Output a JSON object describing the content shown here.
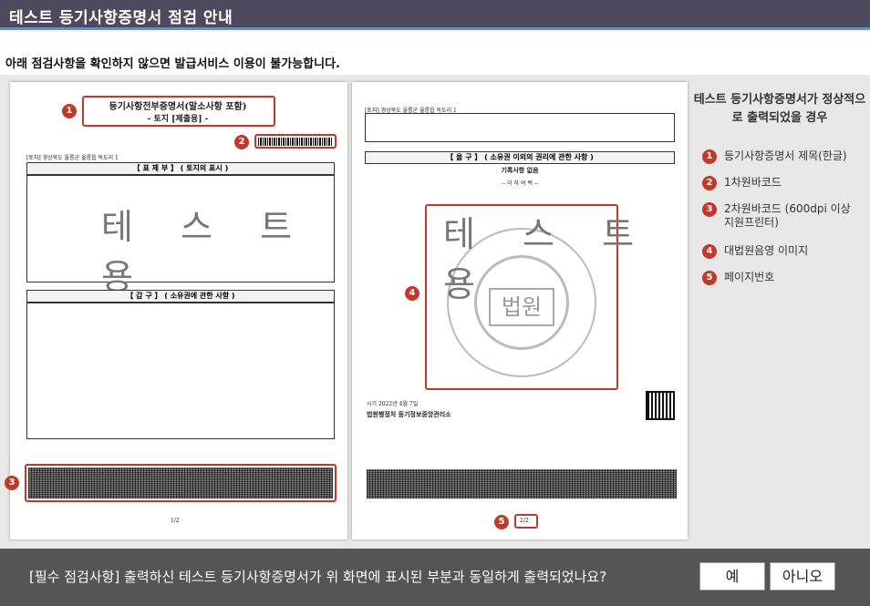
{
  "header": {
    "title": "테스트 등기사항증명서 점검 안내"
  },
  "notice": "아래 점검사항을 확인하지 않으면 발급서비스 이용이 불가능합니다.",
  "page1": {
    "doc_title": "등기사항전부증명서(말소사항 포함)",
    "doc_subtitle": "- 토지 [제출용] -",
    "location": "[토지] 경상북도 울릉군 울릉읍 독도리 1",
    "section_a": "【 표 제 부 】 ( 토지의 표시 )",
    "section_b": "【 갑    구 】 ( 소유권에 관한 사항 )",
    "watermark": "테 스 트 용",
    "page_no": "1/2"
  },
  "page2": {
    "location": "[토지] 경상북도 울릉군 울릉읍 독도리 1",
    "section_c": "【 을    구 】 ( 소유권 이외의 권리에 관한 사항 )",
    "no_record": "기록사항 없음",
    "below": "-- 이 하 여 백 --",
    "watermark": "테 스 트 용",
    "seal_text": "법원",
    "issuer": "법원행정처 등기정보중앙관리소",
    "date": "시기 2022년 4월 7일",
    "page_no": "2/2"
  },
  "legend": {
    "title": "테스트 등기사항증명서가 정상적으로 출력되었을 경우",
    "items": [
      {
        "num": "1",
        "label": "등기사항증명서 제목(한글)"
      },
      {
        "num": "2",
        "label": "1차원바코드"
      },
      {
        "num": "3",
        "label": "2차원바코드 (600dpi 이상 지원프린터)"
      },
      {
        "num": "4",
        "label": "대법원음영 이미지"
      },
      {
        "num": "5",
        "label": "페이지번호"
      }
    ]
  },
  "markers": {
    "m1": "1",
    "m2": "2",
    "m3": "3",
    "m4": "4",
    "m5": "5"
  },
  "footer": {
    "question": "[필수 점검사항] 출력하신 테스트 등기사항증명서가 위 화면에 표시된 부분과 동일하게 출력되었나요?",
    "yes": "예",
    "no": "아니오"
  },
  "colors": {
    "titlebar": "#4e4a5e",
    "accent": "#c0392b",
    "footer": "#555555"
  }
}
